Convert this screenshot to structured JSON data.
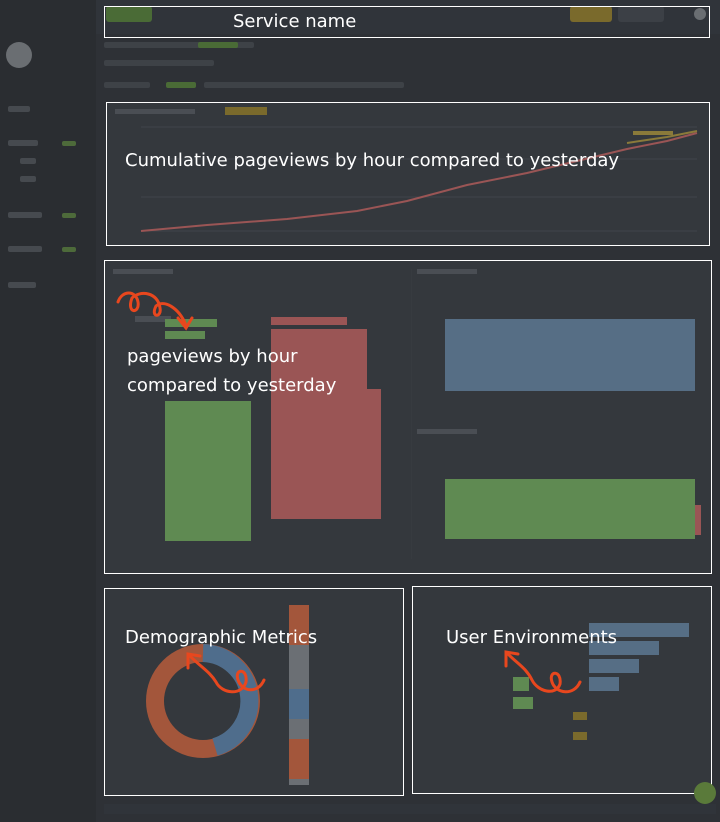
{
  "labels": {
    "service_name": "Service name",
    "cumulative": "Cumulative pageviews by hour compared to yesterday",
    "hourly_line1": "pageviews by hour",
    "hourly_line2": "compared to yesterday",
    "demographic": "Demographic Metrics",
    "environments": "User Environments"
  },
  "colors": {
    "outline": "#ffffff",
    "annotation_arrow": "#e8471e",
    "today_series": "#6b8f5e",
    "yesterday_series": "#9a5555",
    "bar_blue": "#5a7590",
    "bar_green": "#5f8a52",
    "donut_blue": "#4f6d8c",
    "donut_orange": "#a3563b"
  },
  "icons": {
    "annotation": "curly-arrow-icon"
  }
}
